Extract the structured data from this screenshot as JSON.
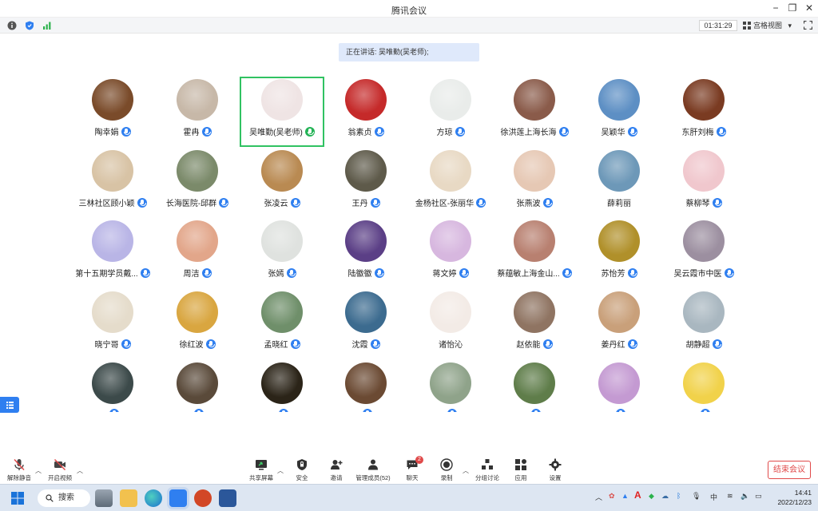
{
  "window": {
    "title": "腾讯会议",
    "minimize": "−",
    "restore": "❐",
    "close": "✕"
  },
  "infobar": {
    "timer": "01:31:29",
    "view_mode": "宫格视图",
    "view_caret": "▾"
  },
  "speaker_banner": "正在讲话: 吴唯勤(吴老师);",
  "participants": [
    {
      "name": "陶幸娟",
      "mic": true,
      "color": "#7a4b2a"
    },
    {
      "name": "霍冉",
      "mic": true,
      "color": "#c7b8a8"
    },
    {
      "name": "吴唯勤(吴老师)",
      "mic": true,
      "speaking": true,
      "color": "#efe4e4"
    },
    {
      "name": "翁素贞",
      "mic": true,
      "color": "#c52a2a"
    },
    {
      "name": "方琼",
      "mic": true,
      "color": "#e9ecea"
    },
    {
      "name": "徐洪莲上海长海",
      "mic": true,
      "color": "#8a5b4a"
    },
    {
      "name": "吴颖华",
      "mic": true,
      "color": "#5d8fc4"
    },
    {
      "name": "东肝刘梅",
      "mic": true,
      "color": "#7a3b22"
    },
    {
      "name": "三林社区顾小颖",
      "mic": true,
      "color": "#d8c3a5"
    },
    {
      "name": "长海医院-邱群",
      "mic": true,
      "color": "#7b8a6a"
    },
    {
      "name": "张凌云",
      "mic": true,
      "color": "#b98a52"
    },
    {
      "name": "王丹",
      "mic": true,
      "color": "#5e5a4a"
    },
    {
      "name": "金杨社区-张丽华",
      "mic": true,
      "color": "#e8d9c4"
    },
    {
      "name": "张燕波",
      "mic": true,
      "color": "#e6c8b4"
    },
    {
      "name": "薛莉丽",
      "mic": false,
      "color": "#6d98b8"
    },
    {
      "name": "蔡柳琴",
      "mic": true,
      "color": "#f0c7cd"
    },
    {
      "name": "第十五期学员戴...",
      "mic": true,
      "color": "#b9b5e6"
    },
    {
      "name": "周洁",
      "mic": true,
      "color": "#e2a68a"
    },
    {
      "name": "张嫣",
      "mic": true,
      "color": "#dfe2df"
    },
    {
      "name": "陆徽徽",
      "mic": true,
      "color": "#5b3f86"
    },
    {
      "name": "蒋文婷",
      "mic": true,
      "color": "#d7b7df"
    },
    {
      "name": "蔡蕴敏上海金山...",
      "mic": true,
      "color": "#b88070"
    },
    {
      "name": "苏怡芳",
      "mic": true,
      "color": "#b0902a"
    },
    {
      "name": "吴云霞市中医",
      "mic": true,
      "color": "#9c8fa0"
    },
    {
      "name": "晓宁哥",
      "mic": true,
      "color": "#e5dccb"
    },
    {
      "name": "徐红波",
      "mic": true,
      "color": "#d9a640"
    },
    {
      "name": "孟晓红",
      "mic": true,
      "color": "#6f8f6a"
    },
    {
      "name": "沈霞",
      "mic": true,
      "color": "#3c6b8f"
    },
    {
      "name": "诸怡沁",
      "mic": false,
      "color": "#f3ebe6"
    },
    {
      "name": "赵依能",
      "mic": true,
      "color": "#8f7462"
    },
    {
      "name": "姜丹红",
      "mic": true,
      "color": "#c9a07a"
    },
    {
      "name": "胡静超",
      "mic": true,
      "color": "#a9b7c0"
    },
    {
      "name": "",
      "mic": true,
      "color": "#3c4a4a"
    },
    {
      "name": "",
      "mic": true,
      "color": "#5a4a3a"
    },
    {
      "name": "",
      "mic": true,
      "color": "#2b2418"
    },
    {
      "name": "",
      "mic": true,
      "color": "#6b4a33"
    },
    {
      "name": "",
      "mic": true,
      "color": "#8fa38a"
    },
    {
      "name": "",
      "mic": true,
      "color": "#5f7d4a"
    },
    {
      "name": "",
      "mic": true,
      "color": "#c49ad2"
    },
    {
      "name": "",
      "mic": true,
      "color": "#f1d24a"
    }
  ],
  "toolbar": {
    "unmute": "解除静音",
    "start_video": "开启视频",
    "share_screen": "共享屏幕",
    "security": "安全",
    "invite": "邀请",
    "manage_members": "管理成员(52)",
    "chat": "聊天",
    "chat_badge": "2",
    "record": "录制",
    "breakout": "分组讨论",
    "apps": "应用",
    "settings": "设置",
    "end_meeting": "结束会议"
  },
  "taskbar": {
    "search": "搜索",
    "ime": "中",
    "time": "14:41",
    "date": "2022/12/23"
  },
  "colors": {
    "accent": "#2f7ff0",
    "speaking": "#24b356",
    "end": "#e04a4a"
  }
}
